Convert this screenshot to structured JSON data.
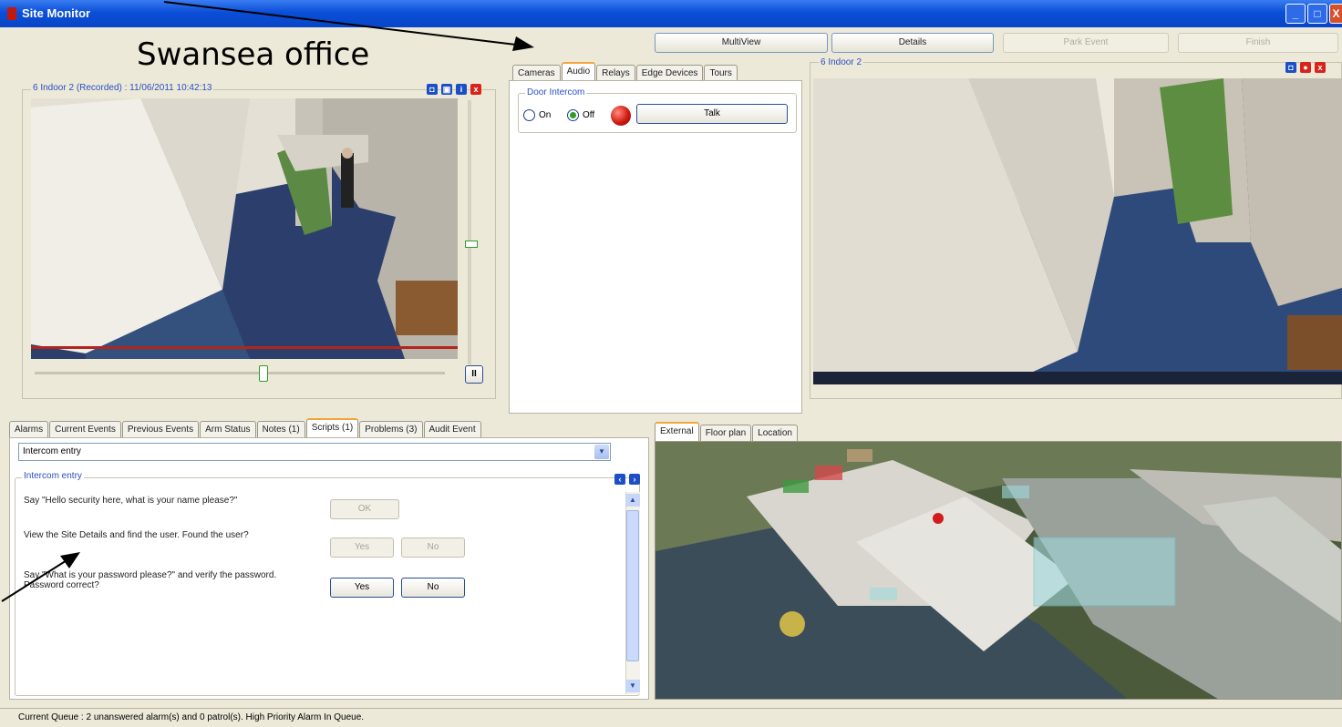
{
  "window": {
    "title": "Site Monitor",
    "min": "_",
    "max": "□",
    "close": "X"
  },
  "site_title": "Swansea office",
  "top_buttons": {
    "multiview": "MultiView",
    "details": "Details",
    "park_event": "Park Event",
    "finish": "Finish"
  },
  "left_camera": {
    "caption": "6 Indoor 2 (Recorded) : 11/06/2011 10:42:13",
    "pause_label": "II"
  },
  "right_camera": {
    "caption": "6 Indoor 2"
  },
  "middle_tabs": [
    "Cameras",
    "Audio",
    "Relays",
    "Edge Devices",
    "Tours"
  ],
  "middle_active_tab": "Audio",
  "audio": {
    "group_title": "Door Intercom",
    "on_label": "On",
    "off_label": "Off",
    "selected": "Off",
    "talk_label": "Talk"
  },
  "bottom_tabs": [
    "Alarms",
    "Current Events",
    "Previous Events",
    "Arm Status",
    "Notes (1)",
    "Scripts (1)",
    "Problems (3)",
    "Audit Event"
  ],
  "bottom_active_tab": "Scripts (1)",
  "script": {
    "selected": "Intercom entry",
    "group_title": "Intercom entry",
    "questions": [
      {
        "text": "Say \"Hello security here, what is your name please?\"",
        "buttons": [
          "OK"
        ]
      },
      {
        "text": "View the Site Details and find the user. Found the user?",
        "buttons": [
          "Yes",
          "No"
        ]
      },
      {
        "text": "Say \"What is your password please?\" and verify the password. Password correct?",
        "buttons": [
          "Yes",
          "No"
        ]
      }
    ]
  },
  "map_tabs": [
    "External",
    "Floor plan",
    "Location"
  ],
  "map_active_tab": "External",
  "status_bar": "Current Queue : 2 unanswered alarm(s) and 0 patrol(s). High Priority Alarm In Queue.",
  "colors": {
    "titlebar": "#0a4fd8",
    "tab_accent": "#f2a53a",
    "group_title": "#2a4fc0"
  }
}
